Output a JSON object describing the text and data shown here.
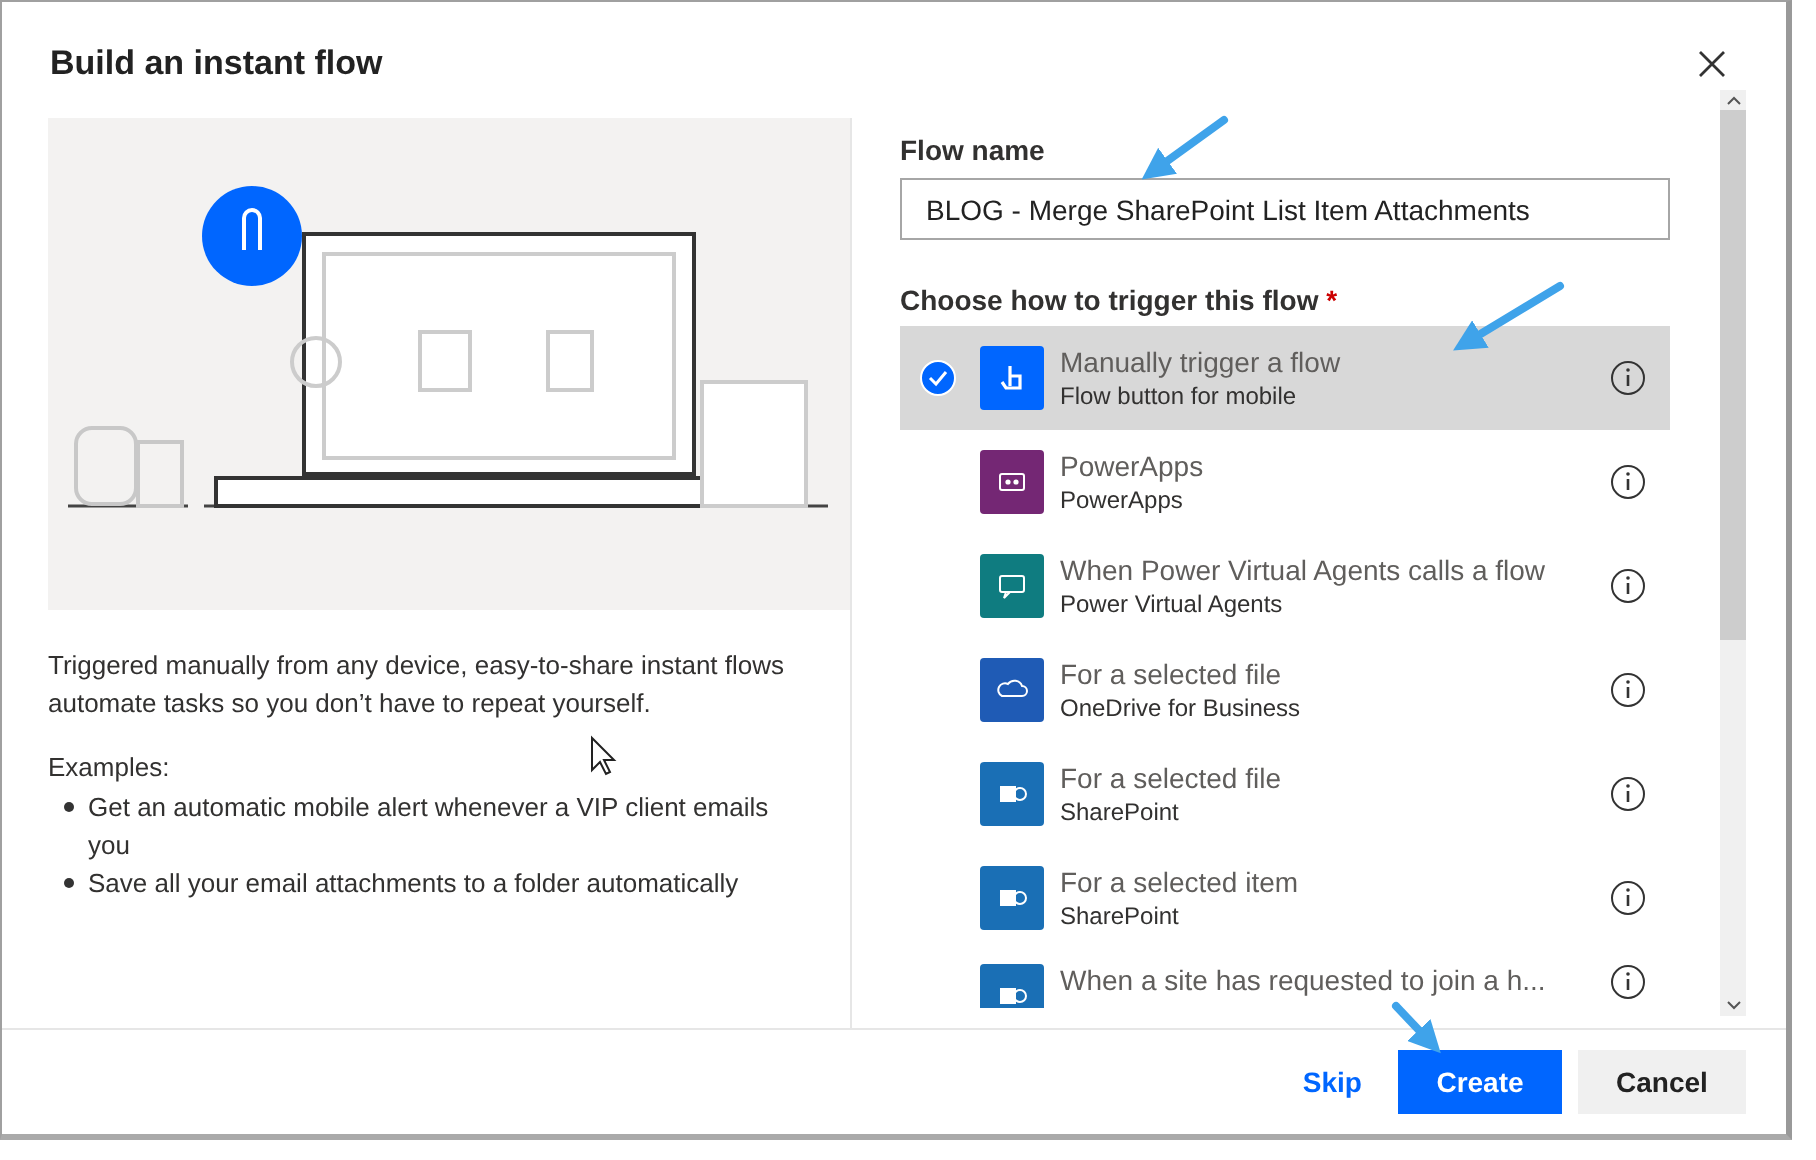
{
  "dialog": {
    "title": "Build an instant flow"
  },
  "description": "Triggered manually from any device, easy-to-share instant flows automate tasks so you don’t have to repeat yourself.",
  "examples": {
    "heading": "Examples:",
    "items": [
      "Get an automatic mobile alert whenever a VIP client emails you",
      "Save all your email attachments to a folder automatically"
    ]
  },
  "flow_name": {
    "label": "Flow name",
    "value": "BLOG - Merge SharePoint List Item Attachments"
  },
  "trigger": {
    "label": "Choose how to trigger this flow",
    "required_mark": "*",
    "options": [
      {
        "title": "Manually trigger a flow",
        "connector": "Flow button for mobile",
        "kind": "touch",
        "color": "#0066ff",
        "selected": true
      },
      {
        "title": "PowerApps",
        "connector": "PowerApps",
        "kind": "powerapps",
        "color": "#742774",
        "selected": false
      },
      {
        "title": "When Power Virtual Agents calls a flow",
        "connector": "Power Virtual Agents",
        "kind": "pva",
        "color": "#0f7c80",
        "selected": false
      },
      {
        "title": "For a selected file",
        "connector": "OneDrive for Business",
        "kind": "onedrive",
        "color": "#1f5bb5",
        "selected": false
      },
      {
        "title": "For a selected file",
        "connector": "SharePoint",
        "kind": "sharepoint",
        "color": "#1a6fb5",
        "selected": false
      },
      {
        "title": "For a selected item",
        "connector": "SharePoint",
        "kind": "sharepoint",
        "color": "#1a6fb5",
        "selected": false
      },
      {
        "title": "When a site has requested to join a h...",
        "kind": "sharepoint",
        "color": "#1a6fb5",
        "selected": false
      }
    ]
  },
  "footer": {
    "skip": "Skip",
    "create": "Create",
    "cancel": "Cancel"
  }
}
